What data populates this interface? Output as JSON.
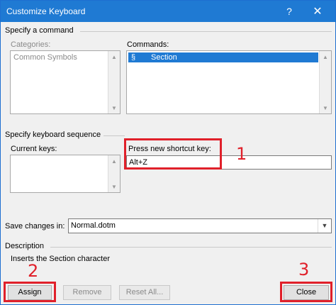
{
  "window": {
    "title": "Customize Keyboard",
    "help_glyph": "?",
    "close_glyph": "✕"
  },
  "specify_command": {
    "title": "Specify a command",
    "categories_label": "Categories:",
    "categories": [
      "Common Symbols"
    ],
    "commands_label": "Commands:",
    "commands": [
      {
        "symbol": "§",
        "name": "Section",
        "selected": true
      }
    ]
  },
  "keyboard_sequence": {
    "title": "Specify keyboard sequence",
    "current_keys_label": "Current keys:",
    "current_keys": [],
    "new_shortcut_label": "Press new shortcut key:",
    "new_shortcut_value": "Alt+Z"
  },
  "save_changes": {
    "label": "Save changes in:",
    "value": "Normal.dotm"
  },
  "description": {
    "title": "Description",
    "text": "Inserts the Section character"
  },
  "buttons": {
    "assign": "Assign",
    "remove": "Remove",
    "reset_all": "Reset All...",
    "close": "Close"
  },
  "annotations": {
    "step1": "1",
    "step2": "2",
    "step3": "3",
    "color": "#e0202a"
  }
}
